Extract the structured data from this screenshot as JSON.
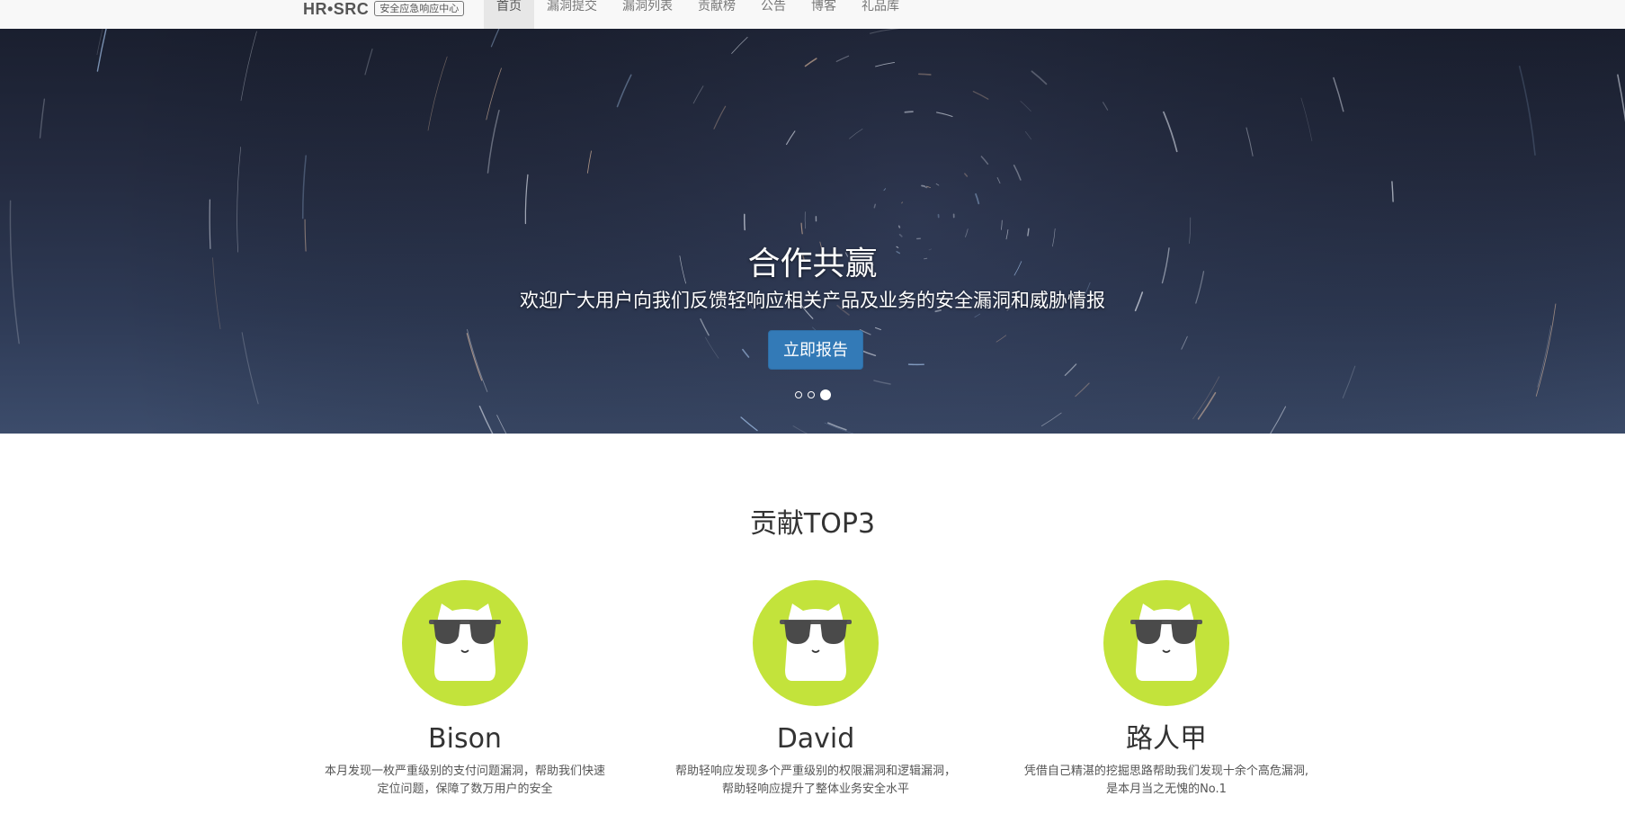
{
  "brand": {
    "logo": "HR•SRC",
    "tagline": "安全应急响应中心"
  },
  "nav": {
    "items": [
      {
        "label": "首页",
        "active": true
      },
      {
        "label": "漏洞提交",
        "active": false
      },
      {
        "label": "漏洞列表",
        "active": false
      },
      {
        "label": "贡献榜",
        "active": false
      },
      {
        "label": "公告",
        "active": false
      },
      {
        "label": "博客",
        "active": false
      },
      {
        "label": "礼品库",
        "active": false
      }
    ]
  },
  "hero": {
    "title": "合作共赢",
    "subtitle": "欢迎广大用户向我们反馈轻响应相关产品及业务的安全漏洞和威胁情报",
    "button_label": "立即报告",
    "active_slide": 3,
    "slide_count": 3
  },
  "top3": {
    "title": "贡献TOP3",
    "cards": [
      {
        "name": "Bison",
        "desc_line1": "本月发现一枚严重级别的支付问题漏洞，帮助我们快速",
        "desc_line2": "定位问题，保障了数万用户的安全"
      },
      {
        "name": "David",
        "desc_line1": "帮助轻响应发现多个严重级别的权限漏洞和逻辑漏洞，",
        "desc_line2": "帮助轻响应提升了整体业务安全水平"
      },
      {
        "name": "路人甲",
        "desc_line1": "凭借自己精湛的挖掘思路帮助我们发现十余个高危漏洞,",
        "desc_line2": "是本月当之无愧的No.1"
      }
    ]
  },
  "colors": {
    "primary_button": "#337ab7",
    "avatar_bg": "#c3e33b",
    "navbar_bg": "#f8f8f8"
  }
}
